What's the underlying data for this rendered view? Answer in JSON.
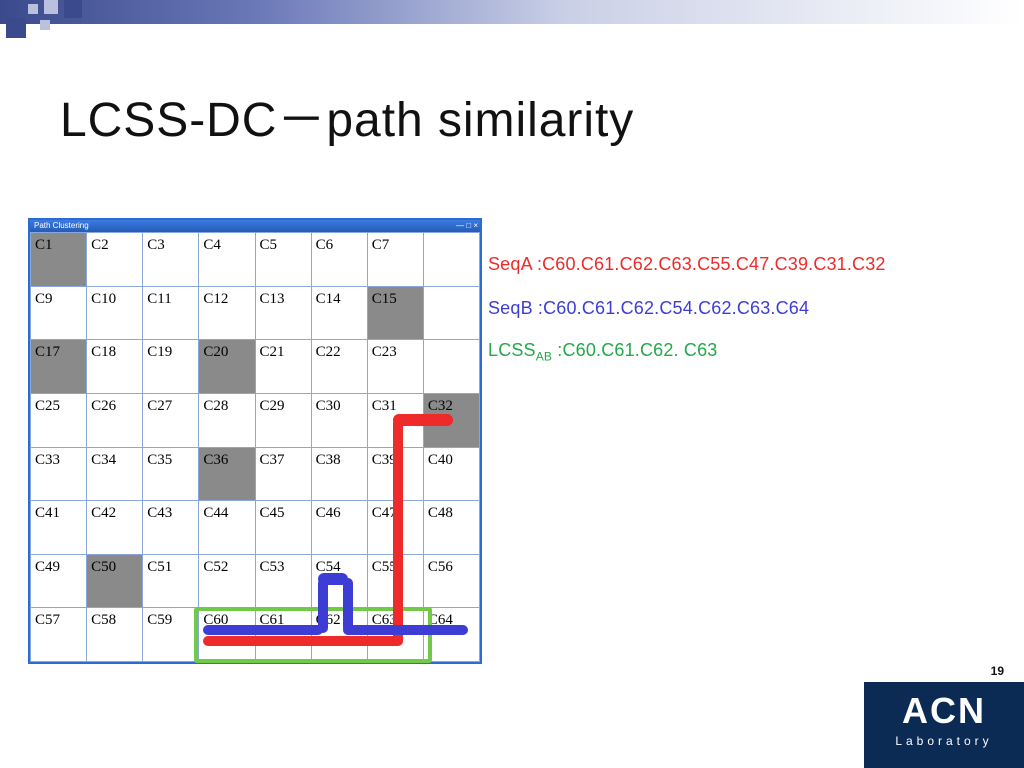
{
  "slide": {
    "title": "LCSS-DC－path similarity",
    "page_number": "19"
  },
  "window": {
    "title": "Path Clustering",
    "controls": "— □ ×"
  },
  "grid": {
    "cells": [
      [
        "C1",
        "C2",
        "C3",
        "C4",
        "C5",
        "C6",
        "C7",
        ""
      ],
      [
        "C9",
        "C10",
        "C11",
        "C12",
        "C13",
        "C14",
        "C15",
        ""
      ],
      [
        "C17",
        "C18",
        "C19",
        "C20",
        "C21",
        "C22",
        "C23",
        ""
      ],
      [
        "C25",
        "C26",
        "C27",
        "C28",
        "C29",
        "C30",
        "C31",
        "C32"
      ],
      [
        "C33",
        "C34",
        "C35",
        "C36",
        "C37",
        "C38",
        "C39",
        "C40"
      ],
      [
        "C41",
        "C42",
        "C43",
        "C44",
        "C45",
        "C46",
        "C47",
        "C48"
      ],
      [
        "C49",
        "C50",
        "C51",
        "C52",
        "C53",
        "C54",
        "C55",
        "C56"
      ],
      [
        "C57",
        "C58",
        "C59",
        "C60",
        "C61",
        "C62",
        "C63",
        "C64"
      ]
    ],
    "obstacles": [
      "C1",
      "C15",
      "C17",
      "C20",
      "C32",
      "C36",
      "C50"
    ]
  },
  "sequences": {
    "seqA_label": "SeqA :",
    "seqA_value": "C60.C61.C62.C63.C55.C47.C39.C31.C32",
    "seqB_label": "SeqB :",
    "seqB_value": "C60.C61.C62.C54.C62.C63.C64",
    "lcss_label_pre": "LCSS",
    "lcss_label_sub": "AB",
    "lcss_label_post": " :",
    "lcss_value": "C60.C61.C62. C63"
  },
  "logo": {
    "big": "ACN",
    "lab": "Laboratory"
  },
  "chart_data": {
    "type": "table",
    "note": "8×8 cell map with obstacle cells shaded; two paths SeqA (red) and SeqB (blue) drawn; LCSS highlighted in green box on cells C60–C63.",
    "grid_size": [
      8,
      8
    ],
    "cell_labels_row_major": [
      "C1",
      "C2",
      "C3",
      "C4",
      "C5",
      "C6",
      "C7",
      "",
      "C9",
      "C10",
      "C11",
      "C12",
      "C13",
      "C14",
      "C15",
      "",
      "C17",
      "C18",
      "C19",
      "C20",
      "C21",
      "C22",
      "C23",
      "",
      "C25",
      "C26",
      "C27",
      "C28",
      "C29",
      "C30",
      "C31",
      "C32",
      "C33",
      "C34",
      "C35",
      "C36",
      "C37",
      "C38",
      "C39",
      "C40",
      "C41",
      "C42",
      "C43",
      "C44",
      "C45",
      "C46",
      "C47",
      "C48",
      "C49",
      "C50",
      "C51",
      "C52",
      "C53",
      "C54",
      "C55",
      "C56",
      "C57",
      "C58",
      "C59",
      "C60",
      "C61",
      "C62",
      "C63",
      "C64"
    ],
    "obstacles": [
      "C1",
      "C15",
      "C17",
      "C20",
      "C32",
      "C36",
      "C50"
    ],
    "seqA_path": [
      "C60",
      "C61",
      "C62",
      "C63",
      "C55",
      "C47",
      "C39",
      "C31",
      "C32"
    ],
    "seqB_path": [
      "C60",
      "C61",
      "C62",
      "C54",
      "C62",
      "C63",
      "C64"
    ],
    "lcss_AB": [
      "C60",
      "C61",
      "C62",
      "C63"
    ],
    "colors": {
      "seqA": "#ee2a2a",
      "seqB": "#3d3dd6",
      "lcss_box": "#71c94a",
      "obstacle": "#8a8a8a"
    }
  }
}
